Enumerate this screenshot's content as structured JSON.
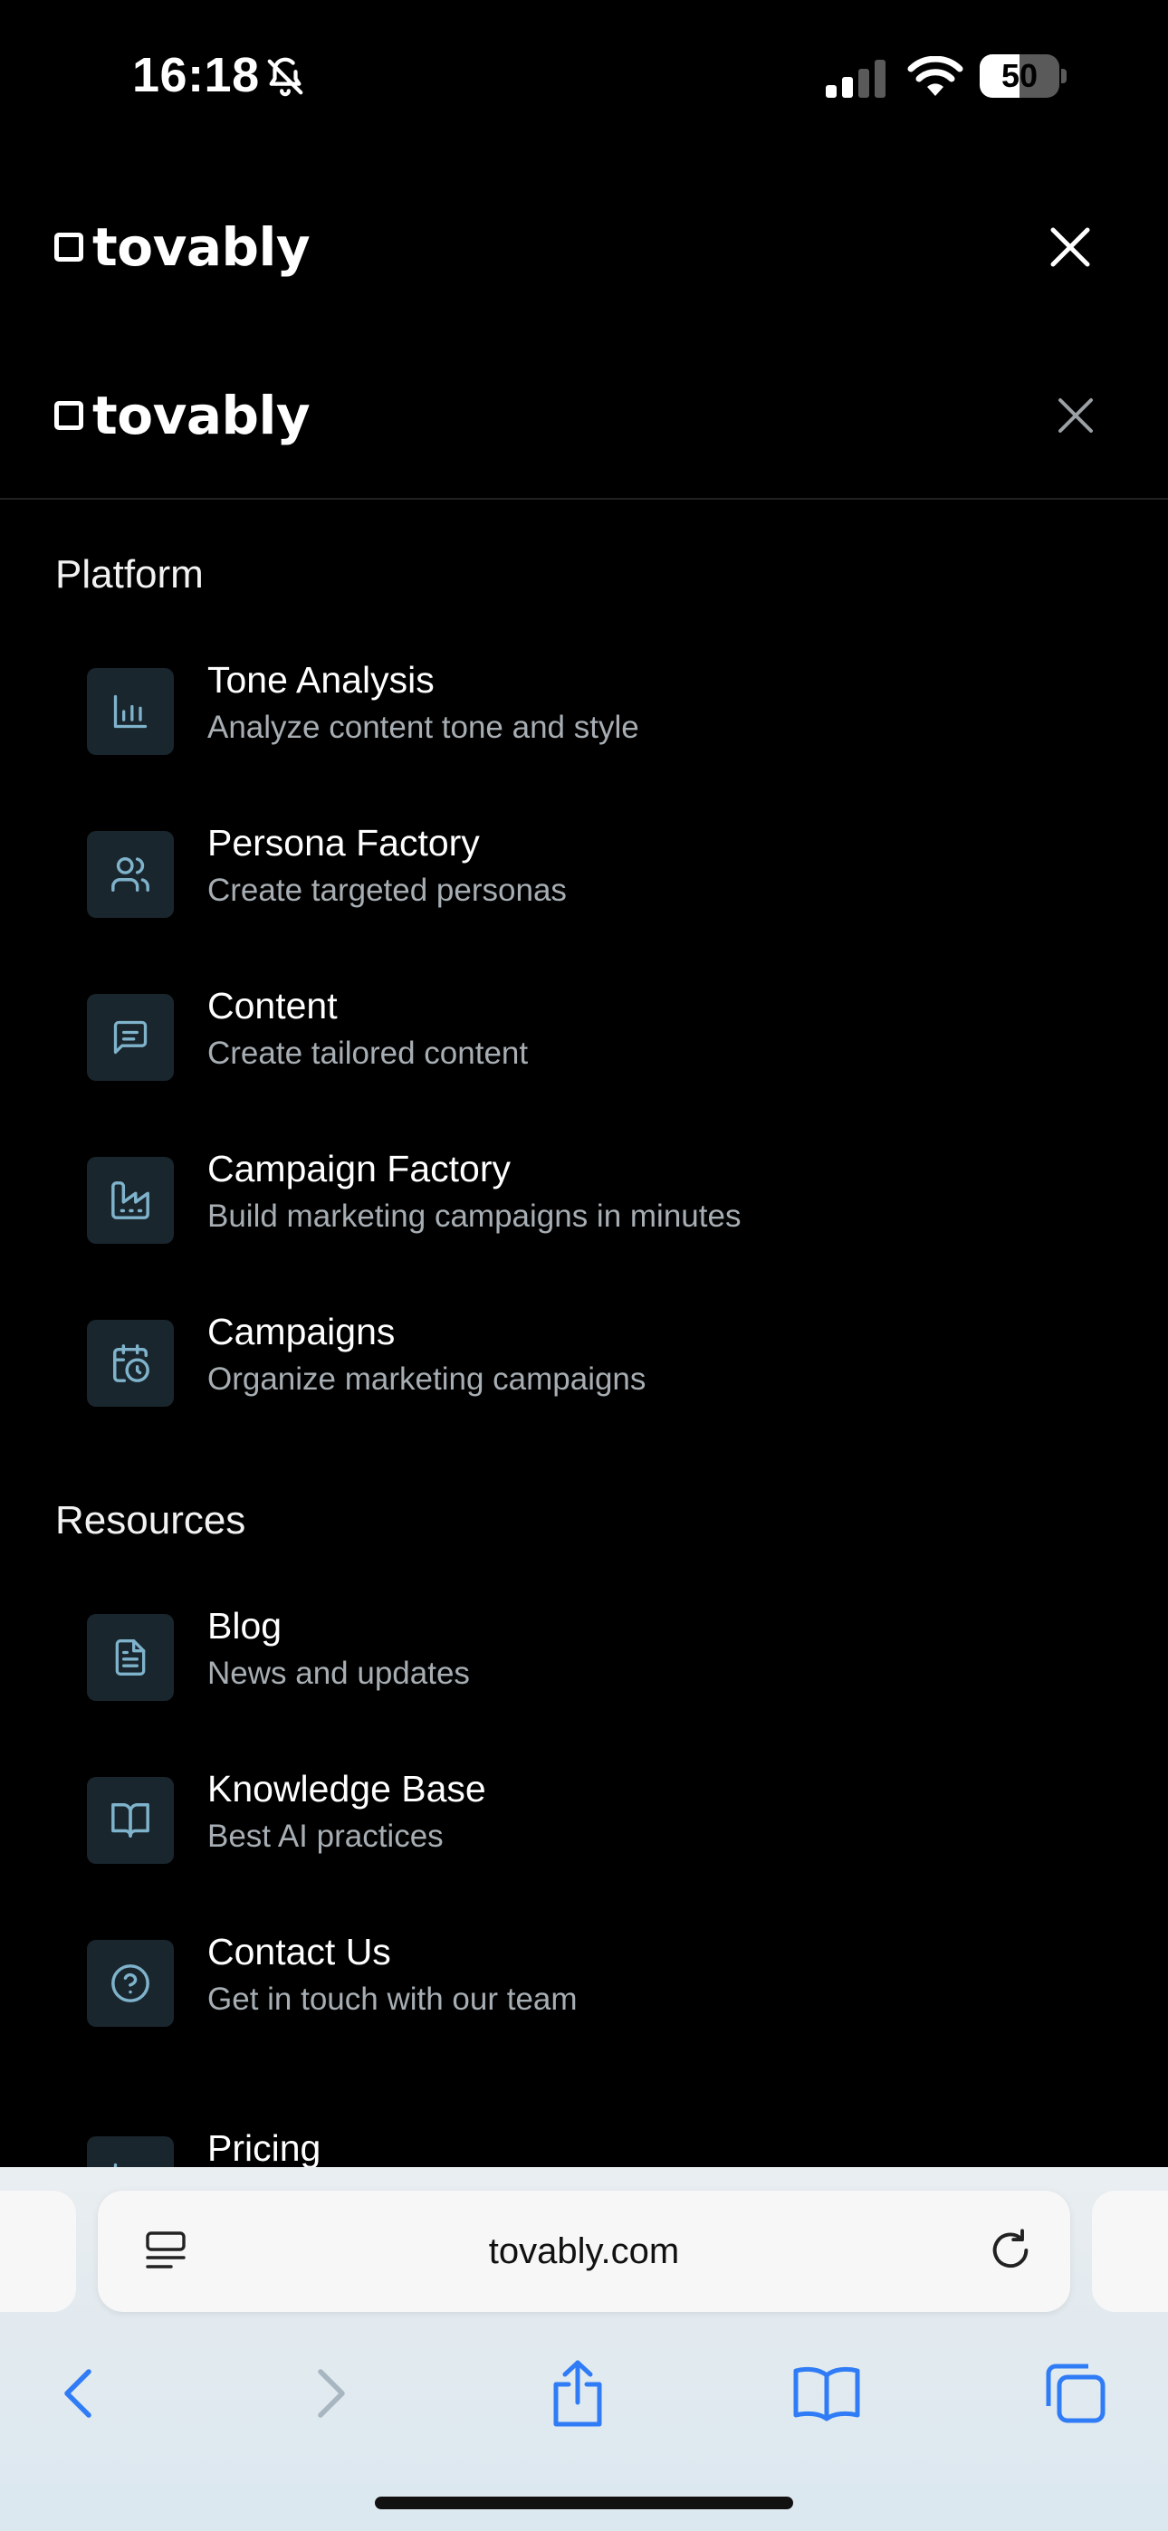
{
  "status_bar": {
    "time": "16:18",
    "battery_percent": "50",
    "battery_level": 0.5,
    "icons": [
      "bell-slash-icon",
      "cellular-signal-icon",
      "wifi-icon",
      "battery-icon"
    ]
  },
  "header": {
    "brand_name": "tovably",
    "close_icon": "close-icon"
  },
  "menu_header": {
    "brand_name": "tovably",
    "close_icon": "close-icon"
  },
  "sections": [
    {
      "title": "Platform",
      "items": [
        {
          "title": "Tone Analysis",
          "description": "Analyze content tone and style",
          "icon": "bar-chart-icon"
        },
        {
          "title": "Persona Factory",
          "description": "Create targeted personas",
          "icon": "users-icon"
        },
        {
          "title": "Content",
          "description": "Create tailored content",
          "icon": "message-square-icon"
        },
        {
          "title": "Campaign Factory",
          "description": "Build marketing campaigns in minutes",
          "icon": "factory-icon"
        },
        {
          "title": "Campaigns",
          "description": "Organize marketing campaigns",
          "icon": "calendar-clock-icon"
        }
      ]
    },
    {
      "title": "Resources",
      "items": [
        {
          "title": "Blog",
          "description": "News and updates",
          "icon": "file-text-icon"
        },
        {
          "title": "Knowledge Base",
          "description": "Best AI practices",
          "icon": "book-open-icon"
        },
        {
          "title": "Contact Us",
          "description": "Get in touch with our team",
          "icon": "help-circle-icon"
        },
        {
          "title": "Pricing",
          "description": "",
          "icon": "bar-chart-icon"
        }
      ]
    }
  ],
  "browser": {
    "url": "tovably.com",
    "toolbar": [
      "back-icon",
      "forward-icon",
      "share-icon",
      "bookmarks-icon",
      "tabs-icon"
    ],
    "colors": {
      "icon_blue": "#2f7cf6",
      "icon_disabled": "#a8b6c2",
      "menu_icon_stroke": "#7fb3cc",
      "menu_icon_bg": "#1a262d"
    }
  }
}
